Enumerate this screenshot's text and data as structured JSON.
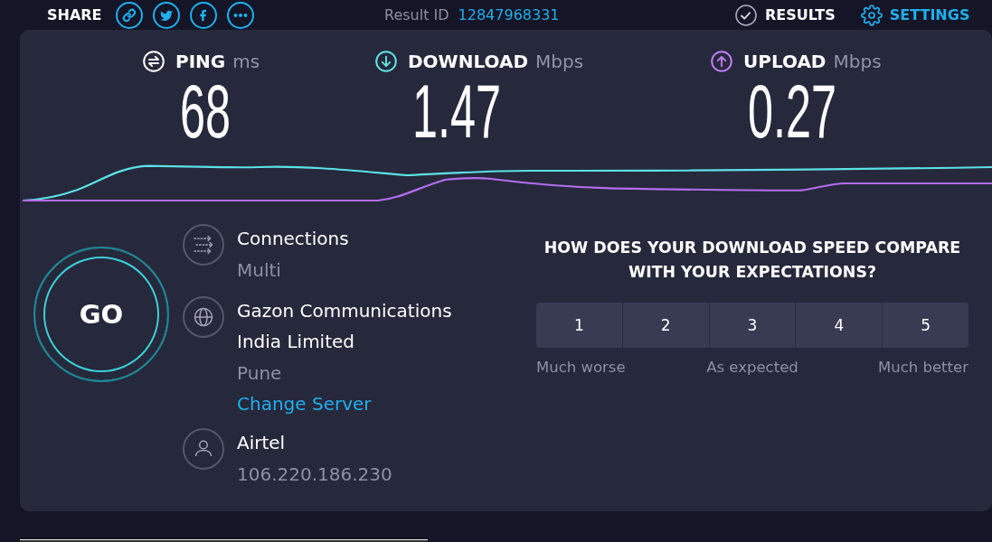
{
  "top_bar": {
    "share_label": "SHARE",
    "share_buttons": [
      {
        "kind": "link"
      },
      {
        "kind": "bird"
      },
      {
        "kind": "f"
      },
      {
        "kind": "more"
      }
    ],
    "result_id_label": "Result ID",
    "result_id": "12847968331",
    "results_link": "RESULTS",
    "settings_link": "SETTINGS"
  },
  "metrics": [
    {
      "kind": "ping",
      "label": "PING",
      "unit": "ms",
      "value": "68"
    },
    {
      "kind": "download",
      "label": "DOWNLOAD",
      "unit": "Mbps",
      "value": "1.47"
    },
    {
      "kind": "upload",
      "label": "UPLOAD",
      "unit": "Mbps",
      "value": "0.27"
    }
  ],
  "go_button": "GO",
  "details": [
    {
      "kind": "connections",
      "title": "Connections",
      "detail": "Multi"
    },
    {
      "kind": "server",
      "title": "Gazon Communications India Limited",
      "detail": "Pune",
      "link": "Change Server"
    },
    {
      "kind": "provider",
      "title": "Airtel",
      "detail": "106.220.186.230"
    }
  ],
  "survey": {
    "question": "HOW DOES YOUR DOWNLOAD SPEED COMPARE WITH YOUR EXPECTATIONS?",
    "options": [
      {
        "label": "1",
        "selected": false
      },
      {
        "label": "2",
        "selected": false
      },
      {
        "label": "3",
        "selected": false
      },
      {
        "label": "4",
        "selected": false
      },
      {
        "label": "5",
        "selected": false
      }
    ],
    "scale_labels": [
      "Much worse",
      "As expected",
      "Much better"
    ]
  }
}
